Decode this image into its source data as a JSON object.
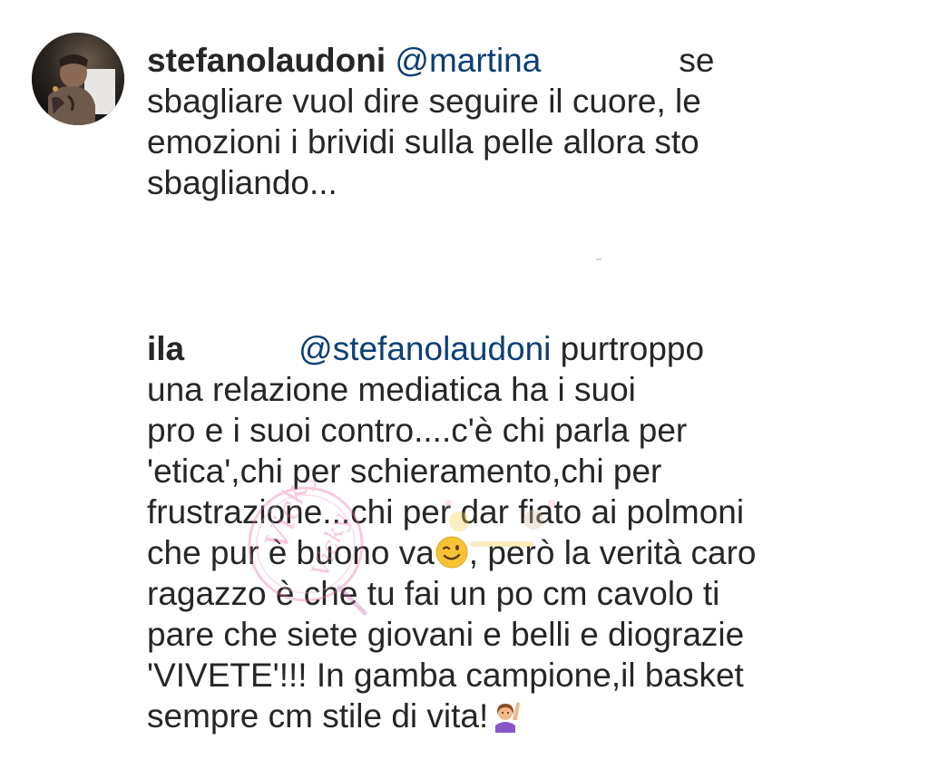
{
  "comments": [
    {
      "username": "stefanolaudoni",
      "mention": "@martina",
      "lines": {
        "l1_tail": "se",
        "l2": "sbagliare vuol dire seguire il cuore, le",
        "l3": "emozioni i brividi sulla pelle allora sto",
        "l4": "sbagliando..."
      }
    },
    {
      "username": "ila",
      "mention": "@stefanolaudoni",
      "lines": {
        "l1_tail": " purtroppo",
        "l2": "una relazione mediatica ha i suoi",
        "l3": "pro e i suoi contro....c'è chi parla per",
        "l4": "'etica',chi per schieramento,chi per",
        "l5": "frustrazione...chi per dar fiato ai polmoni",
        "l6a": "che pur è buono va",
        "l6b": ", però la verità caro",
        "l7": "ragazzo è che tu fai un po cm cavolo ti",
        "l8": "pare che siete giovani e belli e diograzie",
        "l9": "'VIVETE'!!! In gamba campione,il basket",
        "l10": "sempre cm stile di vita!"
      },
      "emojis": [
        "winking-face-emoji",
        "woman-raising-hand-emoji"
      ]
    }
  ],
  "watermark": {
    "text": "Vicky Vicky"
  },
  "colors": {
    "text": "#262626",
    "mention": "#0b3f76",
    "background": "#ffffff"
  }
}
